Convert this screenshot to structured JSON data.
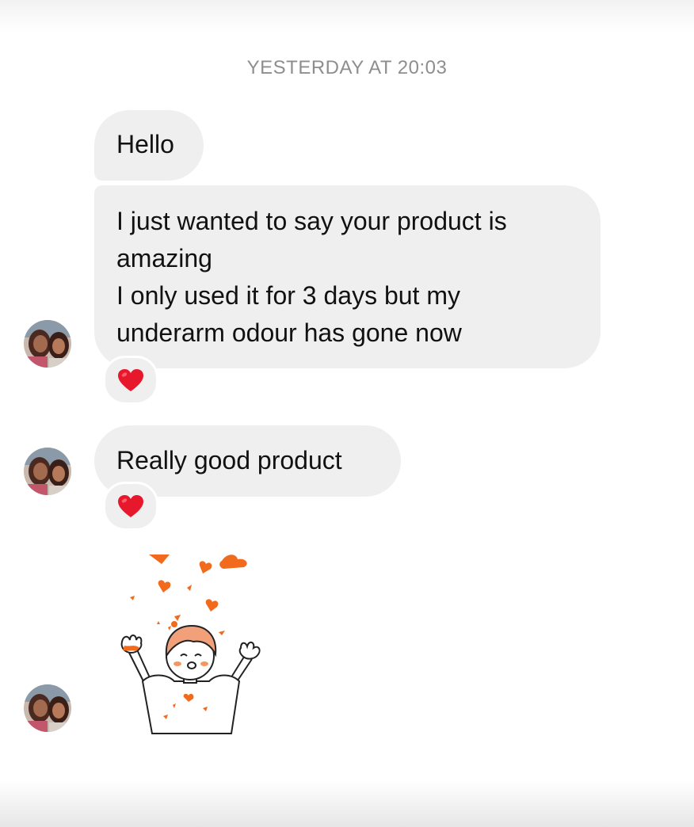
{
  "thread": {
    "timestamp": "YESTERDAY AT 20:03",
    "messages": [
      {
        "text": "Hello"
      },
      {
        "lines": [
          "I just wanted to say your product is",
          "amazing",
          "I only used it for 3 days but my",
          "underarm odour has gone now"
        ],
        "reaction": "red-heart-icon"
      },
      {
        "text": "Really good product",
        "reaction": "red-heart-icon"
      },
      {
        "sticker": "girl-with-falling-hearts-sticker"
      }
    ]
  },
  "colors": {
    "bubble": "#efefef",
    "timestamp": "#8e8e8e",
    "text": "#111111",
    "heart": "#e8182c",
    "sticker_accent": "#f26a1b"
  }
}
